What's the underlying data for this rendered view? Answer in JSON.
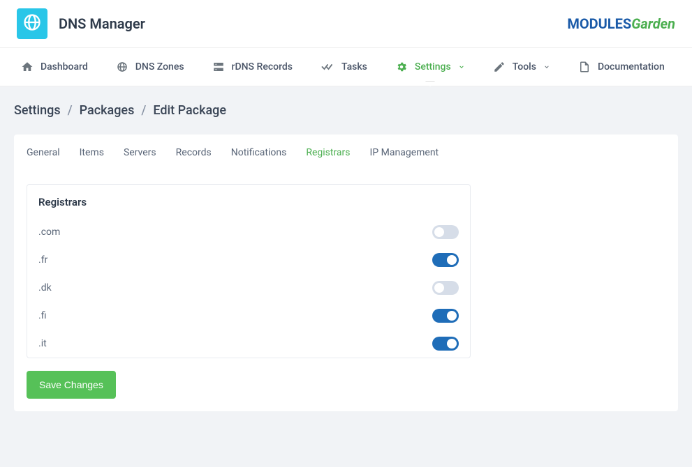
{
  "app_title": "DNS Manager",
  "brand": {
    "modules": "MODULES",
    "garden": "Garden"
  },
  "nav": [
    {
      "label": "Dashboard",
      "active": false
    },
    {
      "label": "DNS Zones",
      "active": false
    },
    {
      "label": "rDNS Records",
      "active": false
    },
    {
      "label": "Tasks",
      "active": false
    },
    {
      "label": "Settings",
      "active": true,
      "dropdown": true
    },
    {
      "label": "Tools",
      "active": false,
      "dropdown": true
    },
    {
      "label": "Documentation",
      "active": false
    }
  ],
  "breadcrumb": {
    "root": "Settings",
    "mid": "Packages",
    "current": "Edit Package"
  },
  "tabs": [
    {
      "label": "General",
      "active": false
    },
    {
      "label": "Items",
      "active": false
    },
    {
      "label": "Servers",
      "active": false
    },
    {
      "label": "Records",
      "active": false
    },
    {
      "label": "Notifications",
      "active": false
    },
    {
      "label": "Registrars",
      "active": true
    },
    {
      "label": "IP Management",
      "active": false
    }
  ],
  "panel": {
    "title": "Registrars",
    "registrars": [
      {
        "tld": ".com",
        "enabled": false
      },
      {
        "tld": ".fr",
        "enabled": true
      },
      {
        "tld": ".dk",
        "enabled": false
      },
      {
        "tld": ".fi",
        "enabled": true
      },
      {
        "tld": ".it",
        "enabled": true
      }
    ]
  },
  "save_label": "Save Changes"
}
